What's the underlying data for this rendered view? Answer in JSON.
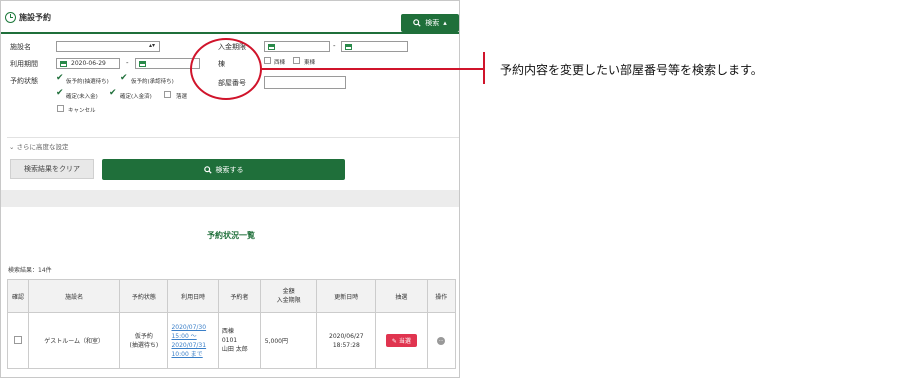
{
  "panel": {
    "title": "施設予約",
    "top_search_label": "検索",
    "facility_label": "施設名",
    "period_label": "利用期間",
    "period_from": "2020-06-29",
    "period_dash": "-",
    "status_label": "予約状態",
    "status_options": [
      {
        "label": "仮予約(抽選待ち)",
        "checked": true
      },
      {
        "label": "仮予約(承認待ち)",
        "checked": true
      },
      {
        "label": "確定(未入金)",
        "checked": true
      },
      {
        "label": "確定(入金済)",
        "checked": true
      },
      {
        "label": "落選",
        "checked": false
      },
      {
        "label": "キャンセル",
        "checked": false
      }
    ],
    "deposit_label": "入金期限",
    "deposit_dash": "-",
    "building_label": "棟",
    "building_options": [
      {
        "label": "西棟",
        "checked": false
      },
      {
        "label": "東棟",
        "checked": false
      }
    ],
    "room_label": "部屋番号",
    "advanced_label": "さらに高度な設定",
    "clear_button": "検索結果をクリア",
    "search_button": "検索する",
    "list_title": "予約状況一覧",
    "result_count": "検索結果：14件"
  },
  "table": {
    "headers": [
      "確認",
      "施設名",
      "予約状態",
      "利用日時",
      "予約者",
      "金額\n入金期限",
      "更新日時",
      "抽選",
      "操作"
    ],
    "rows": [
      {
        "facility": "ゲストルーム（和室）",
        "status_line1": "仮予約",
        "status_line2": "(抽選待ち)",
        "date_lines": [
          "2020/07/30",
          "15:00 ～",
          "2020/07/31",
          "10:00 まで"
        ],
        "reserver_lines": [
          "西棟",
          "0101",
          "山田 太郎"
        ],
        "amount": "5,000円",
        "updated_line1": "2020/06/27",
        "updated_line2": "18:57:28",
        "lottery_button": "当選"
      }
    ]
  },
  "annotation": {
    "text": "予約内容を変更したい部屋番号等を検索します。"
  },
  "colors": {
    "brand_green": "#1f6f3a",
    "annotation_red": "#d0142b",
    "lottery_red": "#e0344f",
    "link_blue": "#3a7fc8"
  }
}
